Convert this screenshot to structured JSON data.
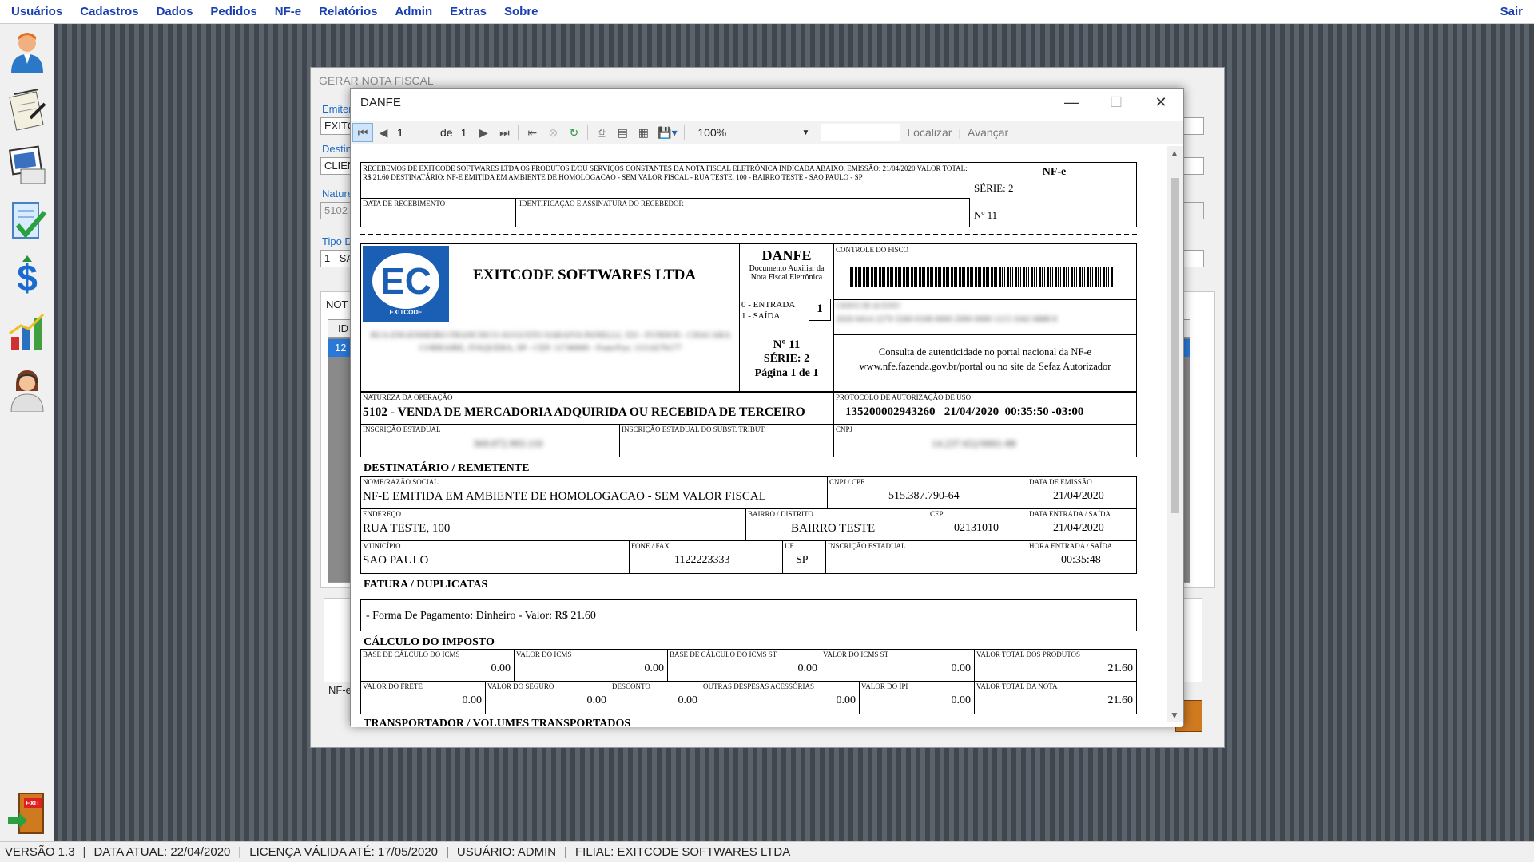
{
  "menu": {
    "items": [
      "Usuários",
      "Cadastros",
      "Dados",
      "Pedidos",
      "NF-e",
      "Relatórios",
      "Admin",
      "Extras",
      "Sobre"
    ],
    "exit": "Sair"
  },
  "sidebar": {
    "icons": [
      "user-icon",
      "notepad-icon",
      "document-icon",
      "checklist-icon",
      "dollar-icon",
      "chart-icon",
      "support-agent-icon",
      "exit-door-icon"
    ],
    "exit_sign": "EXIT"
  },
  "statusbar": {
    "version": "VERSÃO 1.3",
    "date": "DATA ATUAL: 22/04/2020",
    "license": "LICENÇA VÁLIDA ATÉ: 17/05/2020",
    "user": "USUÁRIO: ADMIN",
    "branch": "FILIAL: EXITCODE SOFTWARES LTDA"
  },
  "gerar": {
    "title": "GERAR NOTA FISCAL",
    "emitente_label": "Emiten",
    "emitente_value": "EXITC",
    "destino_label": "Destin",
    "destino_value": "CLIEN",
    "natureza_label": "Nature",
    "natureza_value": "5102 -",
    "tipo_label": "Tipo D",
    "tipo_value": "1 - SA",
    "notas_label": "NOT",
    "grid_header": "ID",
    "grid_row": "12",
    "nfe_label": "NF-e"
  },
  "danfe_window": {
    "title": "DANFE",
    "toolbar": {
      "page": "1",
      "of_label": "de",
      "total_pages": "1",
      "zoom": "100%",
      "find": "Localizar",
      "next": "Avançar"
    }
  },
  "doc": {
    "receipt_text": "RECEBEMOS DE EXITCODE SOFTWARES LTDA OS PRODUTOS E/OU SERVIÇOS CONSTANTES DA NOTA FISCAL ELETRÔNICA INDICADA ABAIXO. EMISSÃO: 21/04/2020 VALOR TOTAL: R$ 21.60 DESTINATÁRIO: NF-E EMITIDA EM AMBIENTE DE HOMOLOGACAO - SEM VALOR FISCAL - RUA TESTE, 100 - BAIRRO TESTE - SAO PAULO - SP",
    "receipt_nfe": "NF-e",
    "receipt_serie": "SÉRIE: 2",
    "receipt_num": "Nº 11",
    "lbl_data_receb": "DATA DE RECEBIMENTO",
    "lbl_ident": "IDENTIFICAÇÃO E ASSINATURA DO RECEBEDOR",
    "logo_text": "EC",
    "logo_sub": "EXITCODE",
    "company": "EXITCODE SOFTWARES LTDA",
    "address_blur": "RUA ENGENHEIRO FRANCISCO AUGUSTO SARAIVA PANELLI, 333 - FUNDOS - CHACARA CORRAIRE, ITAQUERA, SP - CEP: 11740000 - Fone/Fax: 11114276177",
    "danfe_title": "DANFE",
    "danfe_sub1": "Documento Auxiliar da",
    "danfe_sub2": "Nota Fiscal Eletrônica",
    "entrada": "0 - ENTRADA",
    "saida": "1 - SAÍDA",
    "tipo_op": "1",
    "num": "Nº 11",
    "serie": "SÉRIE: 2",
    "pagina": "Página 1 de 1",
    "lbl_controle": "CONTROLE DO FISCO",
    "lbl_chave": "CHAVE DE ACESSO",
    "chave_blur": "2020 0414 2279 3260 0108 0000 2000 0000 1113 1042 6888 8",
    "consulta1": "Consulta de autenticidade no portal nacional da NF-e",
    "consulta2": "www.nfe.fazenda.gov.br/portal ou no site da Sefaz Autorizador",
    "lbl_natureza": "NATUREZA DA OPERAÇÃO",
    "natureza": "5102 - VENDA DE MERCADORIA ADQUIRIDA OU RECEBIDA DE TERCEIRO",
    "lbl_protocolo": "PROTOCOLO DE AUTORIZAÇÃO DE USO",
    "protocolo": "135200002943260   21/04/2020  00:35:50 -03:00",
    "lbl_ie": "INSCRIÇÃO ESTADUAL",
    "ie_blur": "369.072.993.110",
    "lbl_ie_st": "INSCRIÇÃO ESTADUAL DO SUBST. TRIBUT.",
    "lbl_cnpj": "CNPJ",
    "cnpj_blur": "14.237.652/0001-88",
    "sec_dest": "DESTINATÁRIO / REMETENTE",
    "lbl_nome": "NOME/RAZÃO SOCIAL",
    "nome": "NF-E EMITIDA EM AMBIENTE DE HOMOLOGACAO - SEM VALOR FISCAL",
    "lbl_cnpjcpf": "CNPJ / CPF",
    "cnpjcpf": "515.387.790-64",
    "lbl_emissao": "DATA DE EMISSÃO",
    "emissao": "21/04/2020",
    "lbl_endereco": "ENDEREÇO",
    "endereco": "RUA TESTE, 100",
    "lbl_bairro": "BAIRRO / DISTRITO",
    "bairro": "BAIRRO TESTE",
    "lbl_cep": "CEP",
    "cep": "02131010",
    "lbl_entrada_saida": "DATA ENTRADA / SAÍDA",
    "entrada_saida": "21/04/2020",
    "lbl_municipio": "MUNICÍPIO",
    "municipio": "SAO PAULO",
    "lbl_fone": "FONE / FAX",
    "fone": "1122223333",
    "lbl_uf": "UF",
    "uf": "SP",
    "lbl_ie_dest": "INSCRIÇÃO ESTADUAL",
    "lbl_hora": "HORA ENTRADA / SAÍDA",
    "hora": "00:35:48",
    "sec_fatura": "FATURA / DUPLICATAS",
    "fatura": "- Forma De Pagamento: Dinheiro - Valor: R$ 21.60",
    "sec_calculo": "CÁLCULO DO IMPOSTO",
    "calc_row1": [
      {
        "label": "BASE DE CÁLCULO DO ICMS",
        "value": "0.00"
      },
      {
        "label": "VALOR DO ICMS",
        "value": "0.00"
      },
      {
        "label": "BASE DE CÁLCULO DO ICMS ST",
        "value": "0.00"
      },
      {
        "label": "VALOR DO ICMS ST",
        "value": "0.00"
      },
      {
        "label": "VALOR TOTAL DOS PRODUTOS",
        "value": "21.60"
      }
    ],
    "calc_row2": [
      {
        "label": "VALOR DO FRETE",
        "value": "0.00"
      },
      {
        "label": "VALOR DO SEGURO",
        "value": "0.00"
      },
      {
        "label": "DESCONTO",
        "value": "0.00"
      },
      {
        "label": "OUTRAS DESPESAS ACESSÓRIAS",
        "value": "0.00"
      },
      {
        "label": "VALOR DO IPI",
        "value": "0.00"
      },
      {
        "label": "VALOR TOTAL DA NOTA",
        "value": "21.60"
      }
    ],
    "sec_transp": "TRANSPORTADOR / VOLUMES TRANSPORTADOS"
  },
  "colors": {
    "menu_text": "#1a3fb0",
    "label_blue": "#1a6ac8",
    "logo_blue": "#1a5fb4"
  }
}
